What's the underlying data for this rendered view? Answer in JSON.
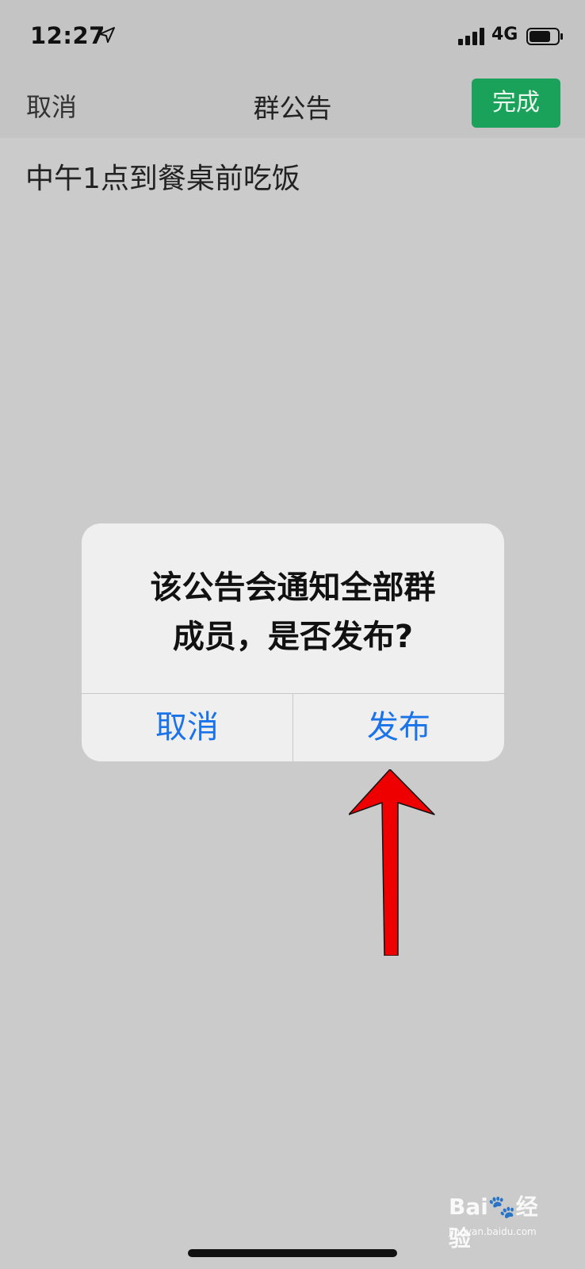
{
  "status_bar": {
    "time": "12:27",
    "network": "4G",
    "icons": [
      "location-arrow-icon",
      "signal-bars-icon",
      "battery-icon"
    ]
  },
  "nav": {
    "cancel_label": "取消",
    "title": "群公告",
    "done_label": "完成",
    "done_color": "#1aa15a"
  },
  "content": {
    "announcement": "中午1点到餐桌前吃饭"
  },
  "alert": {
    "message_line1": "该公告会通知全部群",
    "message_line2": "成员，是否发布?",
    "cancel_label": "取消",
    "publish_label": "发布",
    "button_color": "#1a73e8"
  },
  "overlay": {
    "arrow_color": "#ee0000",
    "watermark_logo": "Bai",
    "watermark_text": "经验",
    "watermark_url": "jingyan.baidu.com"
  }
}
